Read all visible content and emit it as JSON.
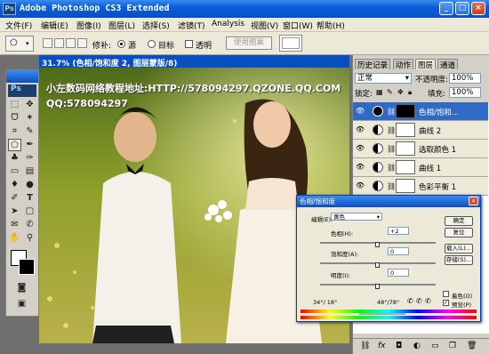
{
  "app": {
    "badge": "Ps",
    "title": "Adobe Photoshop CS3 Extended",
    "win_controls": [
      "_",
      "□",
      "×"
    ]
  },
  "menu": [
    "文件(F)",
    "编辑(E)",
    "图像(I)",
    "图层(L)",
    "选择(S)",
    "滤镜(T)",
    "Analysis",
    "视图(V)",
    "窗口(W)",
    "帮助(H)"
  ],
  "options_bar": {
    "repair_label": "修补:",
    "source_label": "源",
    "target_label": "目标",
    "transparent_label": "透明",
    "use_pattern_label": "使用图案",
    "source_selected": true
  },
  "toolbox": {
    "logo": "Ps"
  },
  "document": {
    "tab_text": "31.7% (色相/饱和度 2, 图层蒙版/8)",
    "watermark_line1": "小左数码网络教程地址:HTTP://578094297.QZONE.QQ.COM",
    "watermark_line2": "QQ:578094297"
  },
  "layers_panel": {
    "tabs": [
      "历史记录",
      "动作",
      "图层",
      "通道"
    ],
    "blend_mode": "正常",
    "opacity_label": "不透明度:",
    "opacity_value": "100%",
    "lock_label": "锁定:",
    "fill_label": "填充:",
    "fill_value": "100%",
    "layers": [
      {
        "name": "色相/饱和...",
        "selected": true
      },
      {
        "name": "曲线 2",
        "selected": false
      },
      {
        "name": "选取颜色 1",
        "selected": false
      },
      {
        "name": "曲线 1",
        "selected": false
      },
      {
        "name": "色彩平衡 1",
        "selected": false
      }
    ],
    "bottom_icons": [
      "link-icon",
      "fx-icon",
      "mask-icon",
      "adjustment-icon",
      "group-icon",
      "new-layer-icon",
      "trash-icon"
    ]
  },
  "hue_saturation_dialog": {
    "title": "色相/饱和度",
    "edit_label": "编辑(E):",
    "edit_value": "黄色",
    "hue_label": "色相(H):",
    "hue_value": "+2",
    "saturation_label": "饱和度(A):",
    "saturation_value": "0",
    "lightness_label": "明度(I):",
    "lightness_value": "0",
    "ok_label": "确定",
    "reset_label": "复位",
    "load_label": "载入(L)...",
    "save_label": "存储(S)...",
    "colorize_label": "着色(O)",
    "preview_label": "预览(P)",
    "preview_checked": true,
    "colorize_checked": false,
    "range_left": "34°/ 18°",
    "range_right": "48°/78°",
    "hue_slider_level": 0.5,
    "saturation_slider_level": 0.5,
    "lightness_slider_level": 0.5
  },
  "colors": {
    "titlebar": "#0a5ed8",
    "selected_layer": "#316ac5",
    "background": "#6f6f6f"
  }
}
